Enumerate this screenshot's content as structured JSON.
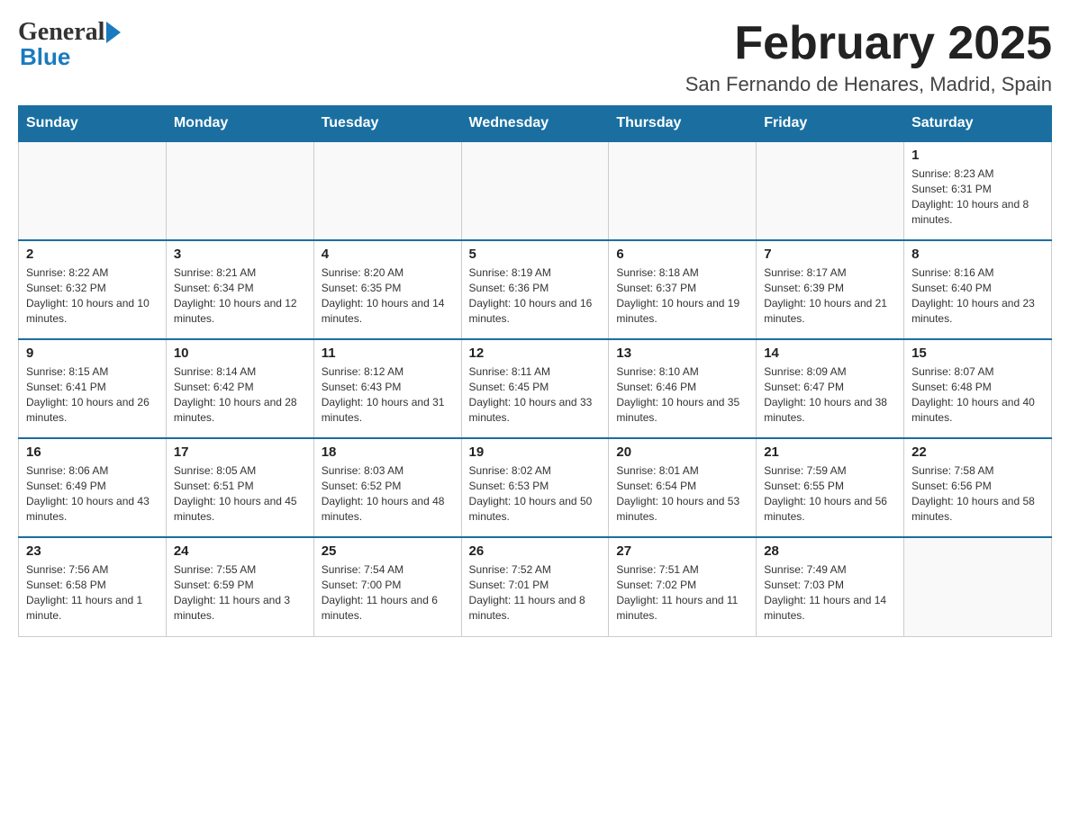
{
  "header": {
    "logo_general": "General",
    "logo_blue": "Blue",
    "month_title": "February 2025",
    "location": "San Fernando de Henares, Madrid, Spain"
  },
  "days_of_week": [
    "Sunday",
    "Monday",
    "Tuesday",
    "Wednesday",
    "Thursday",
    "Friday",
    "Saturday"
  ],
  "weeks": [
    [
      {
        "day": "",
        "info": ""
      },
      {
        "day": "",
        "info": ""
      },
      {
        "day": "",
        "info": ""
      },
      {
        "day": "",
        "info": ""
      },
      {
        "day": "",
        "info": ""
      },
      {
        "day": "",
        "info": ""
      },
      {
        "day": "1",
        "info": "Sunrise: 8:23 AM\nSunset: 6:31 PM\nDaylight: 10 hours and 8 minutes."
      }
    ],
    [
      {
        "day": "2",
        "info": "Sunrise: 8:22 AM\nSunset: 6:32 PM\nDaylight: 10 hours and 10 minutes."
      },
      {
        "day": "3",
        "info": "Sunrise: 8:21 AM\nSunset: 6:34 PM\nDaylight: 10 hours and 12 minutes."
      },
      {
        "day": "4",
        "info": "Sunrise: 8:20 AM\nSunset: 6:35 PM\nDaylight: 10 hours and 14 minutes."
      },
      {
        "day": "5",
        "info": "Sunrise: 8:19 AM\nSunset: 6:36 PM\nDaylight: 10 hours and 16 minutes."
      },
      {
        "day": "6",
        "info": "Sunrise: 8:18 AM\nSunset: 6:37 PM\nDaylight: 10 hours and 19 minutes."
      },
      {
        "day": "7",
        "info": "Sunrise: 8:17 AM\nSunset: 6:39 PM\nDaylight: 10 hours and 21 minutes."
      },
      {
        "day": "8",
        "info": "Sunrise: 8:16 AM\nSunset: 6:40 PM\nDaylight: 10 hours and 23 minutes."
      }
    ],
    [
      {
        "day": "9",
        "info": "Sunrise: 8:15 AM\nSunset: 6:41 PM\nDaylight: 10 hours and 26 minutes."
      },
      {
        "day": "10",
        "info": "Sunrise: 8:14 AM\nSunset: 6:42 PM\nDaylight: 10 hours and 28 minutes."
      },
      {
        "day": "11",
        "info": "Sunrise: 8:12 AM\nSunset: 6:43 PM\nDaylight: 10 hours and 31 minutes."
      },
      {
        "day": "12",
        "info": "Sunrise: 8:11 AM\nSunset: 6:45 PM\nDaylight: 10 hours and 33 minutes."
      },
      {
        "day": "13",
        "info": "Sunrise: 8:10 AM\nSunset: 6:46 PM\nDaylight: 10 hours and 35 minutes."
      },
      {
        "day": "14",
        "info": "Sunrise: 8:09 AM\nSunset: 6:47 PM\nDaylight: 10 hours and 38 minutes."
      },
      {
        "day": "15",
        "info": "Sunrise: 8:07 AM\nSunset: 6:48 PM\nDaylight: 10 hours and 40 minutes."
      }
    ],
    [
      {
        "day": "16",
        "info": "Sunrise: 8:06 AM\nSunset: 6:49 PM\nDaylight: 10 hours and 43 minutes."
      },
      {
        "day": "17",
        "info": "Sunrise: 8:05 AM\nSunset: 6:51 PM\nDaylight: 10 hours and 45 minutes."
      },
      {
        "day": "18",
        "info": "Sunrise: 8:03 AM\nSunset: 6:52 PM\nDaylight: 10 hours and 48 minutes."
      },
      {
        "day": "19",
        "info": "Sunrise: 8:02 AM\nSunset: 6:53 PM\nDaylight: 10 hours and 50 minutes."
      },
      {
        "day": "20",
        "info": "Sunrise: 8:01 AM\nSunset: 6:54 PM\nDaylight: 10 hours and 53 minutes."
      },
      {
        "day": "21",
        "info": "Sunrise: 7:59 AM\nSunset: 6:55 PM\nDaylight: 10 hours and 56 minutes."
      },
      {
        "day": "22",
        "info": "Sunrise: 7:58 AM\nSunset: 6:56 PM\nDaylight: 10 hours and 58 minutes."
      }
    ],
    [
      {
        "day": "23",
        "info": "Sunrise: 7:56 AM\nSunset: 6:58 PM\nDaylight: 11 hours and 1 minute."
      },
      {
        "day": "24",
        "info": "Sunrise: 7:55 AM\nSunset: 6:59 PM\nDaylight: 11 hours and 3 minutes."
      },
      {
        "day": "25",
        "info": "Sunrise: 7:54 AM\nSunset: 7:00 PM\nDaylight: 11 hours and 6 minutes."
      },
      {
        "day": "26",
        "info": "Sunrise: 7:52 AM\nSunset: 7:01 PM\nDaylight: 11 hours and 8 minutes."
      },
      {
        "day": "27",
        "info": "Sunrise: 7:51 AM\nSunset: 7:02 PM\nDaylight: 11 hours and 11 minutes."
      },
      {
        "day": "28",
        "info": "Sunrise: 7:49 AM\nSunset: 7:03 PM\nDaylight: 11 hours and 14 minutes."
      },
      {
        "day": "",
        "info": ""
      }
    ]
  ]
}
